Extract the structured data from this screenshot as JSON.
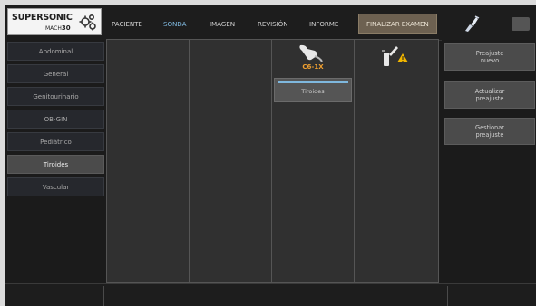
{
  "logo": {
    "brand": "SUPERSONIC",
    "model_prefix": "MACH",
    "model_number": "30"
  },
  "tabs": [
    {
      "label": "PACIENTE",
      "active": false
    },
    {
      "label": "SONDA",
      "active": true
    },
    {
      "label": "IMAGEN",
      "active": false
    },
    {
      "label": "REVISIÓN",
      "active": false
    },
    {
      "label": "INFORME",
      "active": false
    }
  ],
  "finalize_label": "FINALIZAR EXAMEN",
  "presets": [
    {
      "label": "Abdominal",
      "selected": false
    },
    {
      "label": "General",
      "selected": false
    },
    {
      "label": "Genitourinario",
      "selected": false
    },
    {
      "label": "OB-GIN",
      "selected": false
    },
    {
      "label": "Pediátrico",
      "selected": false
    },
    {
      "label": "Tiroides",
      "selected": true
    },
    {
      "label": "Vascular",
      "selected": false
    }
  ],
  "probe": {
    "name": "C6-1X",
    "selected_preset": "Tiroides"
  },
  "actions": [
    {
      "line1": "Preajuste",
      "line2": "nuevo"
    },
    {
      "line1": "Actualizar",
      "line2": "preajuste"
    },
    {
      "line1": "Gestionar",
      "line2": "preajuste"
    }
  ],
  "colors": {
    "accent": "#7fb8de",
    "probe_label": "#f0a030",
    "warning": "#f2b600",
    "finalize_bg": "#6d6151"
  }
}
